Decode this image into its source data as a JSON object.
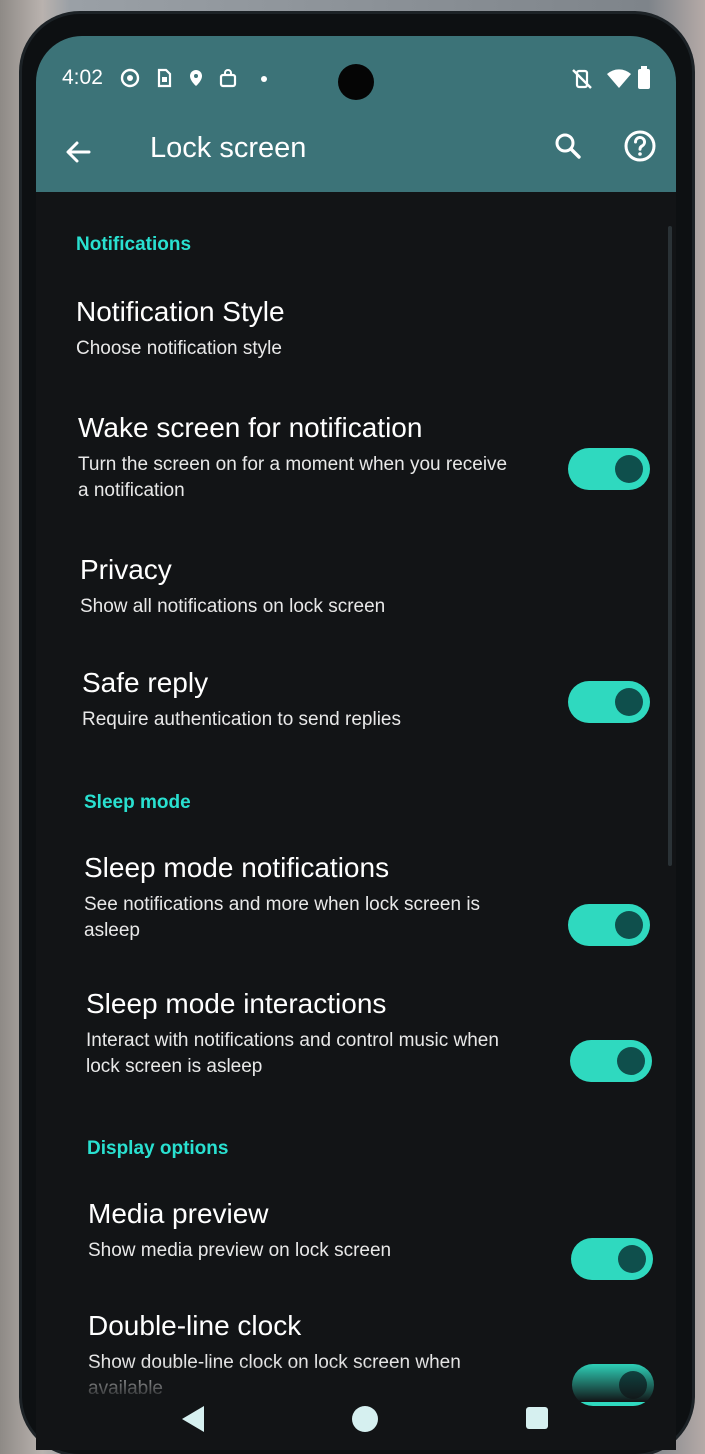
{
  "status_bar": {
    "time": "4:02",
    "left_icons": [
      "whatsapp-icon",
      "sim-icon",
      "maps-pin-icon",
      "shopping-bag-icon",
      "dot-icon"
    ],
    "right_icons": [
      "vibrate-off-icon",
      "wifi-icon",
      "battery-icon"
    ]
  },
  "app_bar": {
    "title": "Lock screen",
    "back_icon": "arrow-back-icon",
    "actions": [
      "search-icon",
      "help-icon"
    ]
  },
  "sections": [
    {
      "header": "Notifications",
      "items": [
        {
          "title": "Notification Style",
          "subtitle": "Choose notification style"
        },
        {
          "title": "Wake screen for notification",
          "subtitle": "Turn the screen on for a moment when you receive a notification",
          "toggle": true
        },
        {
          "title": "Privacy",
          "subtitle": "Show all notifications on lock screen"
        },
        {
          "title": "Safe reply",
          "subtitle": "Require authentication to send replies",
          "toggle": true
        }
      ]
    },
    {
      "header": "Sleep mode",
      "items": [
        {
          "title": "Sleep mode notifications",
          "subtitle": "See notifications and more when lock screen is asleep",
          "toggle": true
        },
        {
          "title": "Sleep mode interactions",
          "subtitle": "Interact with notifications and control music when lock screen is asleep",
          "toggle": true
        }
      ]
    },
    {
      "header": "Display options",
      "items": [
        {
          "title": "Media preview",
          "subtitle": "Show media preview on lock screen",
          "toggle": true
        },
        {
          "title": "Double-line clock",
          "subtitle": "Show double-line clock on lock screen when available",
          "toggle": true
        }
      ]
    }
  ],
  "nav_bar": [
    "back-triangle-icon",
    "home-circle-icon",
    "recents-square-icon"
  ],
  "colors": {
    "accent": "#2fd9bf",
    "section_header": "#29e0d0",
    "app_bar": "#3c7378",
    "background": "#121416"
  }
}
